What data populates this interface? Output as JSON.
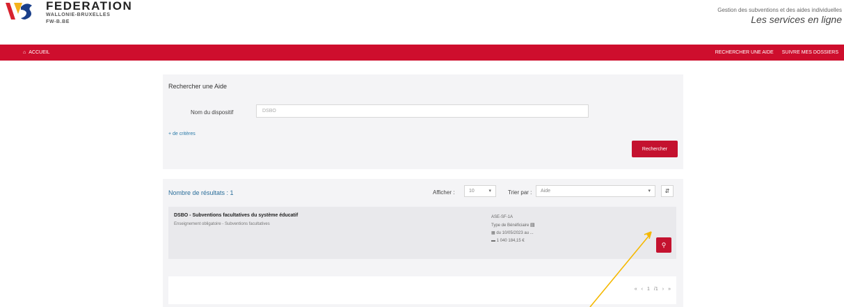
{
  "header": {
    "brand_name": "FEDERATION",
    "brand_sub": "WALLONIE-BRUXELLES",
    "brand_code": "FW-B.BE",
    "top_line": "Gestion des subventions et des aides individuelles",
    "tagline": "Les services en ligne"
  },
  "nav": {
    "home_label": "ACCUEIL",
    "links": [
      "RECHERCHER UNE AIDE",
      "SUIVRE MES DOSSIERS"
    ],
    "colors": {
      "bar": "#ce0e2d"
    }
  },
  "search": {
    "title": "Rechercher une Aide",
    "field_label": "Nom du dispositif",
    "field_value": "DSBO",
    "more_criteria": "+ de critères",
    "button": "Rechercher"
  },
  "results": {
    "count_label": "Nombre de résultats : 1",
    "show_label": "Afficher :",
    "show_value": "10",
    "sort_label": "Trier par :",
    "sort_value": "Aide",
    "items": [
      {
        "title": "DSBO - Subventions facultatives du système éducatif",
        "subtitle": "Enseignement obligatoire - Subventions facultatives",
        "code": "ASE-SF-1A",
        "beneficiary": "Type de Bénéficiaire",
        "date": "du 10/05/2023 au ...",
        "amount": "1 040 184,15 €"
      }
    ],
    "pager": [
      "«",
      "‹",
      "1",
      "/1",
      "›",
      "»"
    ]
  },
  "icons": {
    "home": "home-icon",
    "search": "search-icon",
    "sort": "sort-icon",
    "calendar": "calendar-icon",
    "money": "money-icon",
    "document": "document-icon"
  }
}
